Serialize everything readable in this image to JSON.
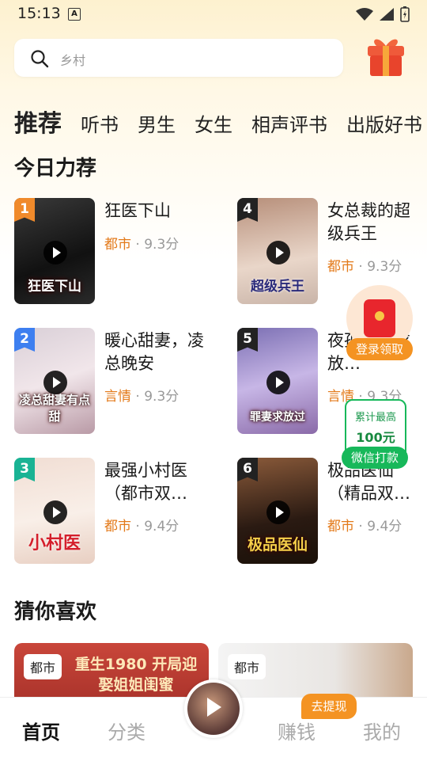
{
  "status": {
    "time": "15:13",
    "app_icon": "A"
  },
  "search": {
    "placeholder": "乡村"
  },
  "tabs": [
    "推荐",
    "听书",
    "男生",
    "女生",
    "相声评书",
    "出版好书"
  ],
  "section_today": "今日力荐",
  "section_guess": "猜你喜欢",
  "books": [
    {
      "rank": "1",
      "title": "狂医下山",
      "cover_text": "狂医下山",
      "category": "都市",
      "score": "9.3分"
    },
    {
      "rank": "4",
      "title": "女总裁的超级兵王",
      "cover_text": "超级兵王",
      "category": "都市",
      "score": "9.3分"
    },
    {
      "rank": "2",
      "title": "暖心甜妻，凌总晚安",
      "cover_text": "凌总甜妻有点甜",
      "category": "言情",
      "score": "9.3分"
    },
    {
      "rank": "5",
      "title": "夜孤罪妻求放…",
      "cover_text": "罪妻求放过",
      "category": "言情",
      "score": "9.3分"
    },
    {
      "rank": "3",
      "title": "最强小村医（都市双…",
      "cover_text": "小村医",
      "category": "都市",
      "score": "9.4分"
    },
    {
      "rank": "6",
      "title": "极品医仙（精品双…",
      "cover_text": "极品医仙",
      "category": "都市",
      "score": "9.4分"
    }
  ],
  "floating": {
    "login_label": "登录领取",
    "wechat_line1": "累计最高",
    "wechat_line2": "100元",
    "wechat_label": "微信打款"
  },
  "recommend": [
    {
      "tag": "都市",
      "banner": "重生1980 开局迎娶姐姐闺蜜"
    },
    {
      "tag": "都市"
    }
  ],
  "bottom_nav": {
    "home": "首页",
    "category": "分类",
    "earn": "赚钱",
    "mine": "我的",
    "withdraw": "去提现"
  },
  "colors": {
    "accent": "#e37a1a",
    "rank1": "#f08a2b",
    "rank2": "#3d7ff0",
    "rank3": "#19b394",
    "rank_dark": "#222222",
    "wechat": "#17b85a",
    "orange_pill": "#f49322"
  }
}
